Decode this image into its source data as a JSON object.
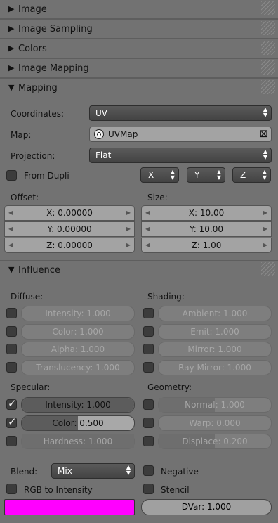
{
  "panels": {
    "image": "Image",
    "image_sampling": "Image Sampling",
    "colors": "Colors",
    "image_mapping": "Image Mapping",
    "mapping": "Mapping",
    "influence": "Influence"
  },
  "mapping": {
    "coordinates_label": "Coordinates:",
    "coordinates_value": "UV",
    "map_label": "Map:",
    "map_value": "UVMap",
    "projection_label": "Projection:",
    "projection_value": "Flat",
    "from_dupli": "From Dupli",
    "axes": [
      "X",
      "Y",
      "Z"
    ],
    "offset_label": "Offset:",
    "size_label": "Size:",
    "offset": [
      "X: 0.00000",
      "Y: 0.00000",
      "Z: 0.00000"
    ],
    "size": [
      "X: 10.00",
      "Y: 10.00",
      "Z: 1.00"
    ]
  },
  "influence": {
    "diffuse_label": "Diffuse:",
    "shading_label": "Shading:",
    "diffuse": [
      {
        "text": "Intensity: 1.000",
        "checked": false
      },
      {
        "text": "Color: 1.000",
        "checked": false
      },
      {
        "text": "Alpha: 1.000",
        "checked": false
      },
      {
        "text": "Translucency: 1.000",
        "checked": false
      }
    ],
    "shading": [
      {
        "text": "Ambient: 1.000",
        "checked": false
      },
      {
        "text": "Emit: 1.000",
        "checked": false
      },
      {
        "text": "Mirror: 1.000",
        "checked": false
      },
      {
        "text": "Ray Mirror: 1.000",
        "checked": false
      }
    ],
    "specular_label": "Specular:",
    "geometry_label": "Geometry:",
    "specular": [
      {
        "text": "Intensity: 1.000",
        "checked": true,
        "fill": 1.0
      },
      {
        "text": "Color: 0.500",
        "checked": true,
        "fill": 0.5
      },
      {
        "text": "Hardness: 1.000",
        "checked": false,
        "fill": 1.0
      }
    ],
    "geometry": [
      {
        "text": "Normal: 1.000",
        "checked": false,
        "fill": 0.5
      },
      {
        "text": "Warp: 0.000",
        "checked": false,
        "fill": 0.0
      },
      {
        "text": "Displace: 0.200",
        "checked": false,
        "fill": 0.5
      }
    ],
    "blend_label": "Blend:",
    "blend_value": "Mix",
    "negative": "Negative",
    "rgb_to_intensity": "RGB to Intensity",
    "stencil": "Stencil",
    "color_swatch": "#ff00ff",
    "dvar": "DVar: 1.000"
  }
}
